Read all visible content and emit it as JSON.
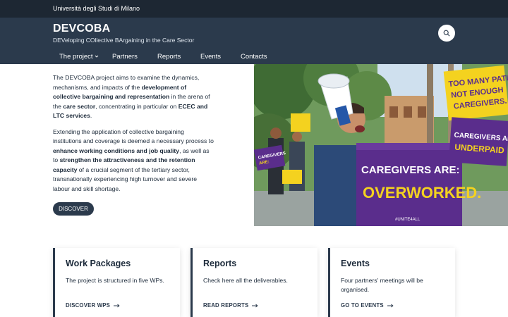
{
  "topbar": {
    "university": "Università degli Studi di Milano"
  },
  "header": {
    "title": "DEVCOBA",
    "subtitle": "DEVeloping COllective BArgaining in the Care Sector",
    "search_icon": "search-icon"
  },
  "nav": {
    "items": [
      {
        "label": "The project"
      },
      {
        "label": "Partners"
      },
      {
        "label": "Reports"
      },
      {
        "label": "Events"
      },
      {
        "label": "Contacts"
      }
    ]
  },
  "intro": {
    "p1": [
      "The DEVCOBA project aims to examine the dynamics, mechanisms, and impacts of the ",
      "development of collective bargaining and representation",
      " in the arena of the ",
      "care sector",
      ", concentrating in particular on ",
      "ECEC and LTC services",
      "."
    ],
    "p2": [
      "Extending the application of collective bargaining institutions and coverage is deemed a necessary process to ",
      "enhance working conditions and job quality",
      ", as well as to ",
      "strengthen the attractiveness and the retention capacity",
      " of a crucial segment of the tertiary sector, transnationally experiencing high turnover and severe labour and skill shortage."
    ],
    "button": "DISCOVER"
  },
  "hero": {
    "signs": {
      "main_line1": "CAREGIVERS ARE:",
      "main_line2": "OVERWORKED.",
      "main_tag": "#UNITE4ALL",
      "yellow_line1": "TOO MANY PATI",
      "yellow_line2": "NOT ENOUGH",
      "yellow_line3": "CAREGIVERS.",
      "right_line1": "CAREGIVERS AR",
      "right_line2": "UNDERPAID",
      "left_line1": "CAREGIVERS",
      "left_line2": "ARE:"
    }
  },
  "cards": [
    {
      "title": "Work Packages",
      "desc": "The project is structured in five WPs.",
      "link": "DISCOVER WPS"
    },
    {
      "title": "Reports",
      "desc": "Check here all the deliverables.",
      "link": "READ REPORTS"
    },
    {
      "title": "Events",
      "desc": "Four partners' meetings will be organised.",
      "link": "GO TO EVENTS"
    }
  ],
  "colors": {
    "topbar": "#1d2733",
    "header": "#2b3a4c",
    "accent_purple": "#5a2d8c",
    "accent_yellow": "#f4d21f"
  }
}
